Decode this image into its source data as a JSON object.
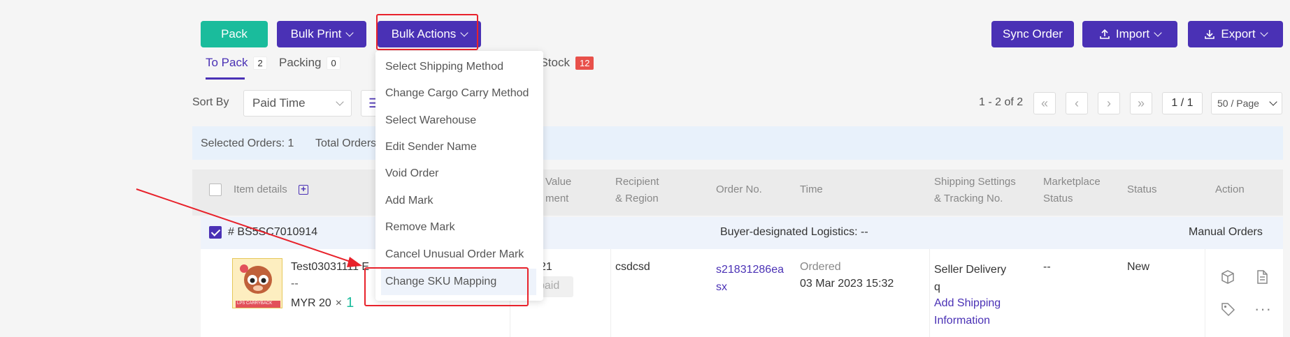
{
  "toolbar": {
    "pack_label": "Pack",
    "bulk_print_label": "Bulk Print",
    "bulk_actions_label": "Bulk Actions",
    "sync_order_label": "Sync Order",
    "import_label": "Import",
    "export_label": "Export"
  },
  "tabs": [
    {
      "label": "To Pack",
      "count": "2"
    },
    {
      "label": "Packing",
      "count": "0"
    },
    {
      "label": "f Stock",
      "count": "12"
    }
  ],
  "sort": {
    "label": "Sort By",
    "value": "Paid Time"
  },
  "pagination": {
    "range": "1 - 2 of 2",
    "page": "1 / 1",
    "per_page": "50 / Page"
  },
  "summary": {
    "selected": "Selected Orders: 1",
    "total": "Total Orders"
  },
  "table_headers": {
    "item_details": "Item details",
    "value_1": "Value",
    "value_2": "ment",
    "recipient_1": "Recipient",
    "recipient_2": "& Region",
    "order_no": "Order No.",
    "time": "Time",
    "shipping_1": "Shipping Settings",
    "shipping_2": "& Tracking No.",
    "marketplace_1": "Marketplace",
    "marketplace_2": "Status",
    "status": "Status",
    "action": "Action"
  },
  "order_group": {
    "id": "# BS5SC7010914",
    "logistics": "Buyer-designated Logistics: --",
    "type": "Manual Orders"
  },
  "order_row": {
    "product_name": "Test03031111 E",
    "product_sub": "--",
    "price": "MYR 20",
    "times": "×",
    "qty": "1",
    "value": "21",
    "payment": "paid",
    "recipient": "csdcsd",
    "order_no_1": "s21831286ea",
    "order_no_2": "sx",
    "time_label": "Ordered",
    "time_value": "03 Mar 2023 15:32",
    "shipping_1": "Seller Delivery",
    "shipping_2": "q",
    "add_shipping_1": "Add Shipping",
    "add_shipping_2": "Information",
    "marketplace_status": "--",
    "status": "New",
    "thumb_text": "LPS CARRYBACK"
  },
  "bulk_menu": [
    "Select Shipping Method",
    "Change Cargo Carry Method",
    "Select Warehouse",
    "Edit Sender Name",
    "Void Order",
    "Add Mark",
    "Remove Mark",
    "Cancel Unusual Order Mark",
    "Change SKU Mapping"
  ],
  "colors": {
    "green": "#1abc9c",
    "purple": "#4a31b5",
    "annotation_red": "#e8222b"
  }
}
